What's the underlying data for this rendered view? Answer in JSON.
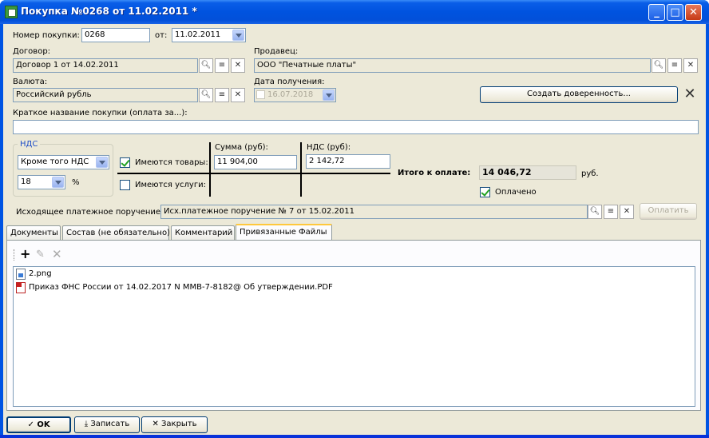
{
  "window": {
    "title": "Покупка №0268 от 11.02.2011 *"
  },
  "header": {
    "number_label": "Номер покупки:",
    "number_value": "0268",
    "from_label": "от:",
    "date_value": "11.02.2011"
  },
  "contract": {
    "label": "Договор:",
    "value": "Договор 1 от 14.02.2011"
  },
  "seller": {
    "label": "Продавец:",
    "value": "ООО \"Печатные платы\""
  },
  "currency": {
    "label": "Валюта:",
    "value": "Российский рубль"
  },
  "receive_date": {
    "label": "Дата получения:",
    "value": "16.07.2018"
  },
  "create_power_button": "Создать доверенность...",
  "short_name": {
    "label": "Краткое название покупки (оплата за...):",
    "value": ""
  },
  "vat": {
    "group_label": "НДС",
    "mode": "Кроме того НДС",
    "rate": "18",
    "percent": "%"
  },
  "items": {
    "goods_label": "Имеются товары:",
    "goods_checked": true,
    "services_label": "Имеются услуги:",
    "services_checked": false,
    "sum_header": "Сумма (руб):",
    "vat_header": "НДС (руб):",
    "goods_sum": "11 904,00",
    "goods_vat": "2 142,72"
  },
  "total": {
    "label": "Итого к оплате:",
    "value": "14 046,72",
    "currency": "руб."
  },
  "paid": {
    "label": "Оплачено",
    "checked": true
  },
  "payment_order": {
    "label": "Исходящее платежное поручение:",
    "value": "Исх.платежное поручение № 7 от 15.02.2011",
    "pay_button": "Оплатить"
  },
  "tabs": [
    "Документы",
    "Состав (не обязательно)",
    "Комментарий",
    "Привязанные Файлы"
  ],
  "active_tab": 3,
  "files": [
    {
      "name": "2.png",
      "type": "png"
    },
    {
      "name": "Приказ ФНС России от 14.02.2017 N ММВ-7-8182@ Об утверждении.PDF",
      "type": "pdf"
    }
  ],
  "footer": {
    "ok": "OK",
    "save": "Записать",
    "close": "Закрыть"
  }
}
